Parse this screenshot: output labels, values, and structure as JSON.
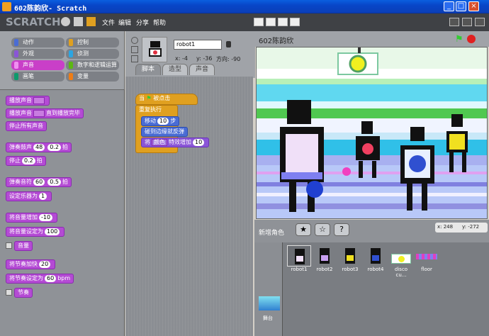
{
  "window": {
    "title": "602陈韵欣- Scratch"
  },
  "menu": {
    "logo": "SCRATCH",
    "file": "文件",
    "edit": "编辑",
    "share": "分享",
    "help": "帮助"
  },
  "categories": [
    {
      "label": "动作",
      "color": "#4a6cd4"
    },
    {
      "label": "控制",
      "color": "#e0a020"
    },
    {
      "label": "外观",
      "color": "#8a55d7"
    },
    {
      "label": "侦测",
      "color": "#2ca5e2"
    },
    {
      "label": "声音",
      "color": "#c93fc8"
    },
    {
      "label": "数字和逻辑运算",
      "color": "#5cb712"
    },
    {
      "label": "画笔",
      "color": "#0e9a6c"
    },
    {
      "label": "变量",
      "color": "#ee7d16"
    }
  ],
  "palette": {
    "play_sound": "播放声音",
    "play_until_done": "直到播放完毕",
    "stop_all_sounds": "停止所有声音",
    "play_drum": "弹奏鼓声",
    "drum_val": "48",
    "drum_beats": "0.2",
    "beats": "拍",
    "rest": "停止",
    "rest_val": "0.2",
    "play_note": "弹奏音符",
    "note_val": "60",
    "note_beats": "0.5",
    "set_instrument": "设定乐器为",
    "inst_val": "1",
    "change_volume": "将音量增加",
    "vol_delta": "-10",
    "set_volume": "将音量设定为",
    "vol_val": "100",
    "volume": "音量",
    "change_tempo": "将节奏加快",
    "tempo_delta": "20",
    "set_tempo": "将节奏设定为",
    "tempo_val": "60",
    "bpm": "bpm",
    "tempo": "节奏"
  },
  "sprite": {
    "name": "robot1",
    "x": "x: -4",
    "y": "y: -36",
    "direction": "方向: -90"
  },
  "tabs": [
    "脚本",
    "造型",
    "声音"
  ],
  "script": {
    "when_flag": "当",
    "clicked": "被点击",
    "forever": "重复执行",
    "move": "移动",
    "move_steps": "10",
    "steps": "步",
    "bounce": "碰到边缘就反弹",
    "change": "将",
    "effect": "颜色",
    "effect_by": "特效增加",
    "effect_val": "10"
  },
  "stage": {
    "title": "602陈韵欣",
    "mouse_x": "x: 248",
    "mouse_y": "y: -272"
  },
  "new_sprite": {
    "label": "新增角色"
  },
  "sprites": [
    "robot1",
    "robot2",
    "robot3",
    "robot4",
    "disco cu...",
    "floor"
  ],
  "stage_label": "舞台"
}
